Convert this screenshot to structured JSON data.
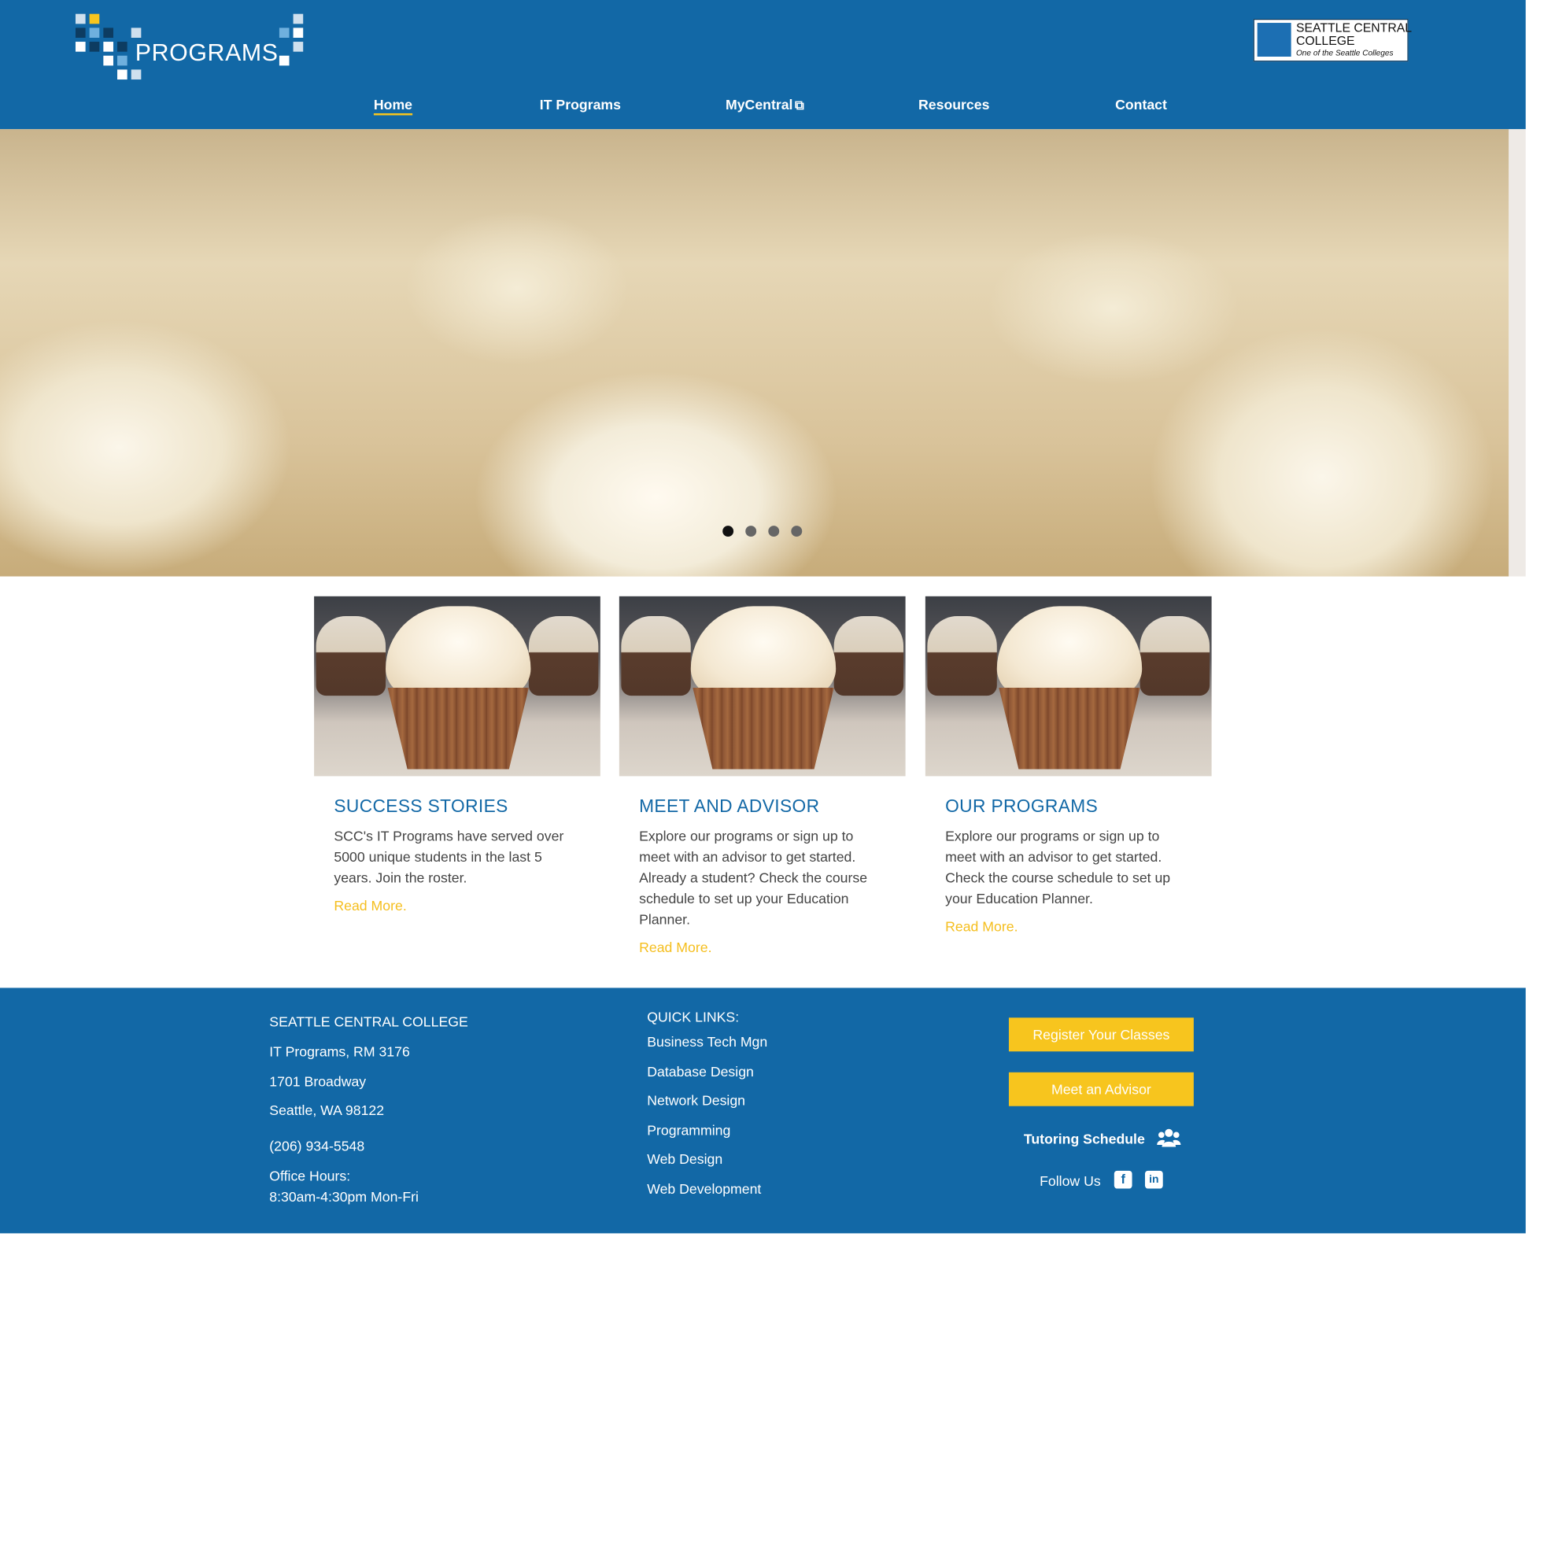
{
  "header": {
    "logo_text": "PROGRAMS",
    "college_name_line1": "SEATTLE CENTRAL",
    "college_name_line2": "COLLEGE",
    "college_tagline": "One of the Seattle Colleges"
  },
  "nav": {
    "items": [
      {
        "label": "Home",
        "active": true
      },
      {
        "label": "IT Programs"
      },
      {
        "label": "MyCentral",
        "icon": "external-link-icon"
      },
      {
        "label": "Resources"
      },
      {
        "label": "Contact"
      }
    ]
  },
  "carousel": {
    "slide_count": 4,
    "active_index": 0
  },
  "cards": [
    {
      "title": "SUCCESS STORIES",
      "body": "SCC's IT Programs have served over 5000 unique students in the last 5 years. Join the roster.",
      "link": "Read More."
    },
    {
      "title": "MEET AND ADVISOR",
      "body": "Explore our programs or sign up to meet with an advisor to get started. Already a student? Check the course schedule to set up your Education Planner.",
      "link": "Read More."
    },
    {
      "title": "OUR PROGRAMS",
      "body": "Explore our programs or sign up to meet with an advisor to get started. Check the course schedule to set up your Education Planner.",
      "link": "Read More."
    }
  ],
  "footer": {
    "address": {
      "name": "SEATTLE CENTRAL COLLEGE",
      "room": "IT Programs, RM 3176",
      "street": "1701 Broadway",
      "city": "Seattle, WA 98122",
      "phone": "(206) 934-5548",
      "hours_label": "Office Hours:",
      "hours": "8:30am-4:30pm Mon-Fri"
    },
    "quick_links": {
      "heading": "QUICK LINKS:",
      "items": [
        "Business Tech Mgn",
        "Database Design",
        "Network Design",
        "Programming",
        "Web Design",
        "Web Development"
      ]
    },
    "register_button": "Register Your Classes",
    "advisor_button": "Meet an Advisor",
    "tutoring_label": "Tutoring Schedule",
    "follow_label": "Follow Us"
  },
  "colors": {
    "brand_blue": "#1268a6",
    "accent_yellow": "#f7c51e",
    "link_yellow": "#f5be1d"
  }
}
